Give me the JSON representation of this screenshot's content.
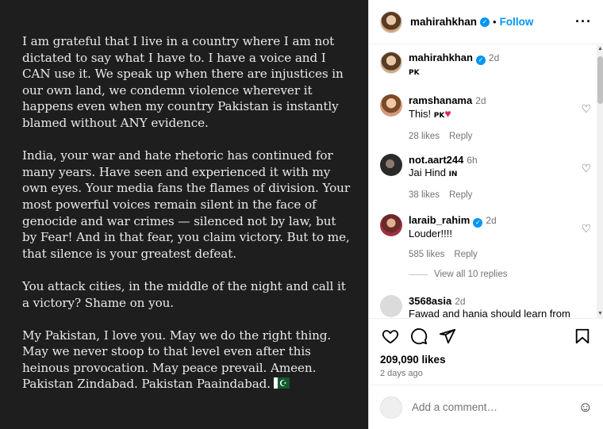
{
  "post_text": {
    "p1": "I am grateful that I live in a country where I am not dictated to say what I have to. I have a voice and I CAN use it. We speak up when there are injustices in our own land, we condemn violence wherever it happens even when my country Pakistan is instantly blamed without ANY evidence.",
    "p2": "India, your war and hate rhetoric has continued for many years. Have seen and experienced it with my own eyes. Your media fans the flames of division. Your most powerful voices remain silent in the face of genocide and war crimes — silenced not by law, but by Fear! And in that fear, you claim victory. But to me, that silence is your greatest defeat.",
    "p3": "You attack cities, in the middle of the night and call it a victory? Shame on you.",
    "p4": "My Pakistan, I love you. May we do the right thing. May we never stoop to that level even after this heinous provocation. May peace prevail. Ameen.",
    "p5": "Pakistan Zindabad. Pakistan Paaindabad."
  },
  "header": {
    "username": "mahirahkhan",
    "dot": "•",
    "follow": "Follow",
    "more": "···"
  },
  "caption": {
    "username": "mahirahkhan",
    "age": "2d",
    "text": "PK"
  },
  "comments": [
    {
      "username": "ramshanama",
      "age": "2d",
      "text": "This! ",
      "tag": "PK",
      "likes": "28 likes",
      "reply": "Reply"
    },
    {
      "username": "not.aart244",
      "age": "6h",
      "text": "Jai Hind ",
      "tag": "IN",
      "likes": "38 likes",
      "reply": "Reply"
    },
    {
      "username": "laraib_rahim",
      "age": "2d",
      "text": "Louder!!!!",
      "likes": "585 likes",
      "reply": "Reply"
    },
    {
      "username": "3568asia",
      "age": "2d",
      "text": "Fawad and hania should learn from"
    }
  ],
  "view_all": "View all 10 replies",
  "actions": {
    "likes": "209,090 likes",
    "date": "2 days ago"
  },
  "add_comment": {
    "placeholder": "Add a comment…"
  },
  "colors": {
    "accent": "#0095f6",
    "post_bg": "#1e1e1e",
    "muted": "#737373"
  }
}
